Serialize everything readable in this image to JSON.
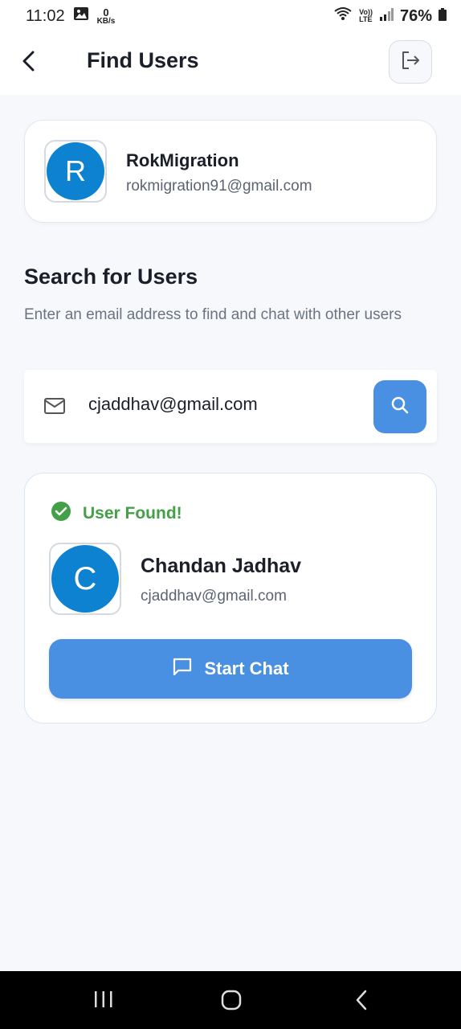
{
  "status_bar": {
    "time": "11:02",
    "speed_value": "0",
    "speed_unit": "KB/s",
    "lte_top": "Vo))",
    "lte_bottom": "LTE",
    "battery": "76%",
    "icons": [
      "gallery-icon",
      "wifi-icon",
      "signal-icon",
      "battery-icon"
    ]
  },
  "header": {
    "title": "Find Users",
    "back_icon": "chevron-left-icon",
    "logout_icon": "logout-icon"
  },
  "current_user": {
    "initial": "R",
    "name": "RokMigration",
    "email": "rokmigration91@gmail.com"
  },
  "search_section": {
    "title": "Search for Users",
    "subtitle": "Enter an email address to find and chat with other users",
    "input_value": "cjaddhav@gmail.com",
    "input_icon": "mail-icon",
    "button_icon": "search-icon"
  },
  "result": {
    "status_text": "User Found!",
    "status_icon": "check-circle-icon",
    "initial": "C",
    "name": "Chandan Jadhav",
    "email": "cjaddhav@gmail.com",
    "start_chat_label": "Start Chat",
    "start_chat_icon": "chat-bubble-icon"
  },
  "colors": {
    "accent": "#4a90e2",
    "avatar": "#0c82d0",
    "success": "#43a047",
    "background": "#f6f8fb"
  },
  "nav_bar": {
    "items": [
      "recents-icon",
      "home-icon",
      "back-icon"
    ]
  }
}
